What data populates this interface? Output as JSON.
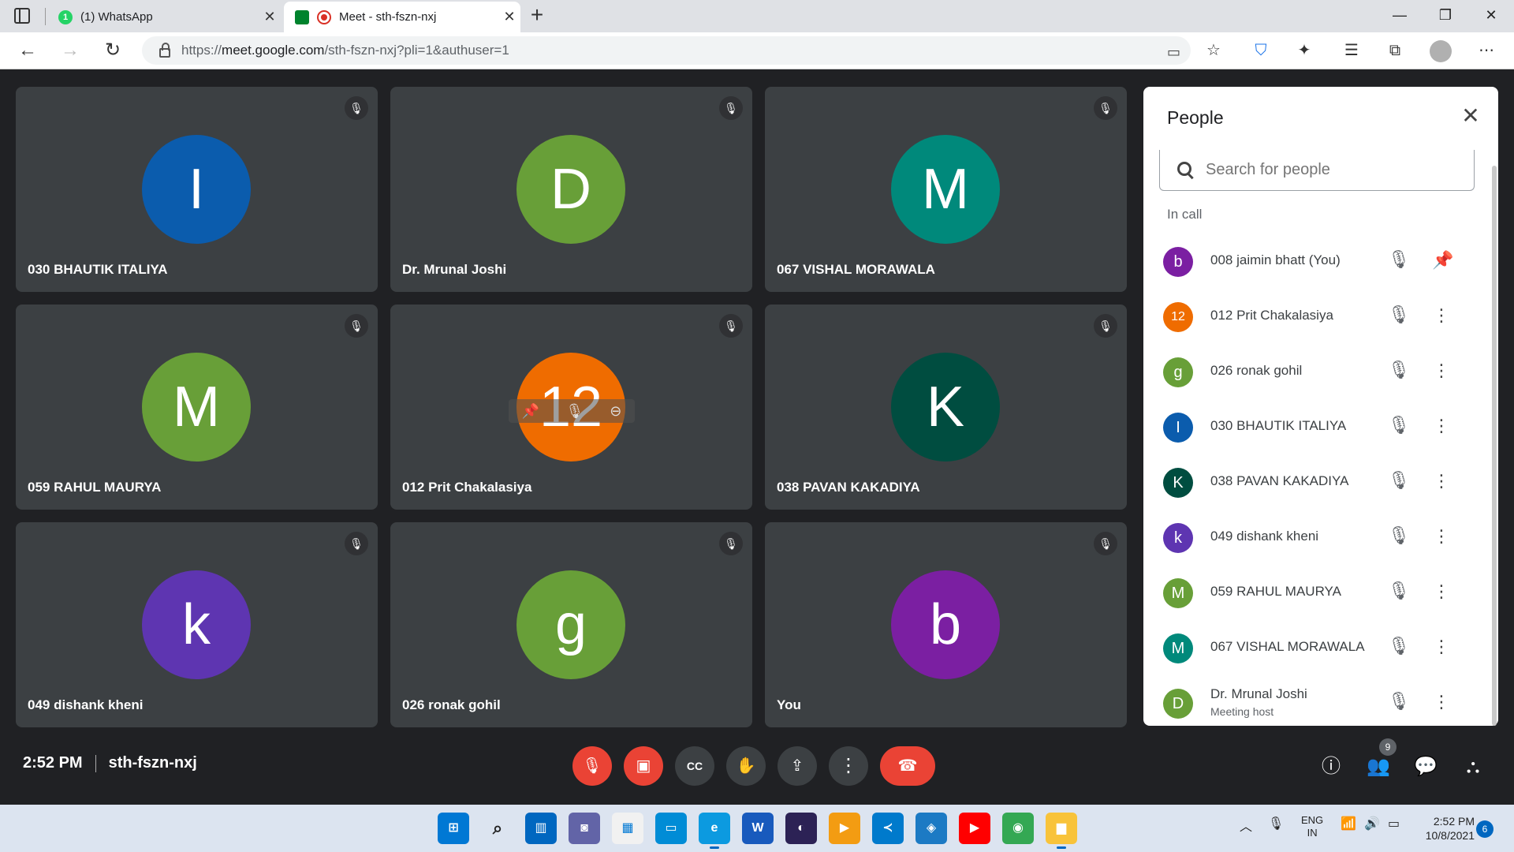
{
  "browser": {
    "tabs": [
      {
        "title": "(1) WhatsApp",
        "badge": "1",
        "active": false
      },
      {
        "title": "Meet - sth-fszn-nxj",
        "active": true
      }
    ],
    "url": {
      "prefix": "https://",
      "host": "meet.google.com",
      "path": "/sth-fszn-nxj?pli=1&authuser=1"
    }
  },
  "tiles": [
    {
      "initial": "I",
      "name": "030 BHAUTIK ITALIYA",
      "color": "#0b5cad"
    },
    {
      "initial": "D",
      "name": "Dr. Mrunal Joshi",
      "color": "#689f38"
    },
    {
      "initial": "M",
      "name": "067 VISHAL MORAWALA",
      "color": "#00897b"
    },
    {
      "initial": "M",
      "name": "059 RAHUL MAURYA",
      "color": "#689f38"
    },
    {
      "initial": "12",
      "name": "012 Prit Chakalasiya",
      "color": "#ef6c00"
    },
    {
      "initial": "K",
      "name": "038 PAVAN KAKADIYA",
      "color": "#004d40"
    },
    {
      "initial": "k",
      "name": "049 dishank kheni",
      "color": "#5e35b1"
    },
    {
      "initial": "g",
      "name": "026 ronak gohil",
      "color": "#689f38"
    },
    {
      "initial": "b",
      "name": "You",
      "color": "#7b1fa2"
    }
  ],
  "people_panel": {
    "title": "People",
    "search_placeholder": "Search for people",
    "section_label": "In call",
    "participants": [
      {
        "initial": "b",
        "name": "008 jaimin bhatt (You)",
        "color": "#7b1fa2",
        "action_icon": "pin-icon"
      },
      {
        "initial": "12",
        "name": "012 Prit Chakalasiya",
        "color": "#ef6c00",
        "action_icon": "more-icon"
      },
      {
        "initial": "g",
        "name": "026 ronak gohil",
        "color": "#689f38",
        "action_icon": "more-icon"
      },
      {
        "initial": "I",
        "name": "030 BHAUTIK ITALIYA",
        "color": "#0b5cad",
        "action_icon": "more-icon"
      },
      {
        "initial": "K",
        "name": "038 PAVAN KAKADIYA",
        "color": "#004d40",
        "action_icon": "more-icon"
      },
      {
        "initial": "k",
        "name": "049 dishank kheni",
        "color": "#5e35b1",
        "action_icon": "more-icon"
      },
      {
        "initial": "M",
        "name": "059 RAHUL MAURYA",
        "color": "#689f38",
        "action_icon": "more-icon"
      },
      {
        "initial": "M",
        "name": "067 VISHAL MORAWALA",
        "color": "#00897b",
        "action_icon": "more-icon"
      },
      {
        "initial": "D",
        "name": "Dr. Mrunal Joshi",
        "subtitle": "Meeting host",
        "color": "#689f38",
        "action_icon": "more-icon"
      }
    ]
  },
  "meeting": {
    "time": "2:52 PM",
    "code": "sth-fszn-nxj",
    "people_count": "9"
  },
  "taskbar": {
    "lang_line1": "ENG",
    "lang_line2": "IN",
    "time": "2:52 PM",
    "date": "10/8/2021",
    "notifications": "6"
  }
}
